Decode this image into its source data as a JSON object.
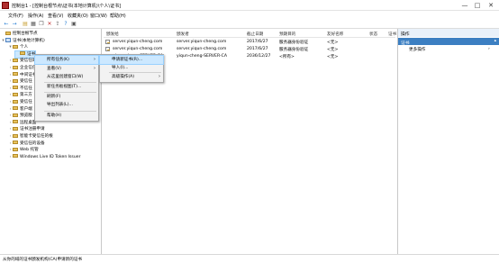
{
  "window": {
    "title": "控制台1 - [控制台根节点\\证书(本地计算机)\\个人\\证书]",
    "controls": [
      "—",
      "□",
      "✕"
    ]
  },
  "menubar": [
    "文件(F)",
    "操作(A)",
    "查看(V)",
    "收藏夹(O)",
    "窗口(W)",
    "帮助(H)"
  ],
  "toolbar_icons": [
    "back-icon",
    "forward-icon",
    "up-folder-icon",
    "console-tree-icon",
    "copy-icon",
    "delete-icon",
    "export-icon",
    "help-icon",
    "properties-icon"
  ],
  "tree": [
    {
      "label": "控制台根节点",
      "depth": 0,
      "twisty": "",
      "icon": "folder"
    },
    {
      "label": "证书(本地计算机)",
      "depth": 0,
      "twisty": "▾",
      "icon": "pc"
    },
    {
      "label": "个人",
      "depth": 1,
      "twisty": "▾",
      "icon": "folder"
    },
    {
      "label": "证书",
      "depth": 2,
      "twisty": "",
      "icon": "folder"
    },
    {
      "label": "受信任的",
      "depth": 1,
      "twisty": "›",
      "icon": "folder"
    },
    {
      "label": "企业信任",
      "depth": 1,
      "twisty": "›",
      "icon": "folder"
    },
    {
      "label": "中间证书",
      "depth": 1,
      "twisty": "›",
      "icon": "folder"
    },
    {
      "label": "受信任",
      "depth": 1,
      "twisty": "›",
      "icon": "folder"
    },
    {
      "label": "不信任",
      "depth": 1,
      "twisty": "›",
      "icon": "folder"
    },
    {
      "label": "第三方",
      "depth": 1,
      "twisty": "›",
      "icon": "folder"
    },
    {
      "label": "受信任",
      "depth": 1,
      "twisty": "›",
      "icon": "folder"
    },
    {
      "label": "客户端",
      "depth": 1,
      "twisty": "›",
      "icon": "folder"
    },
    {
      "label": "预览版",
      "depth": 1,
      "twisty": "›",
      "icon": "folder"
    },
    {
      "label": "远程桌面",
      "depth": 1,
      "twisty": "›",
      "icon": "folder"
    },
    {
      "label": "证书注册申请",
      "depth": 1,
      "twisty": "›",
      "icon": "folder"
    },
    {
      "label": "智能卡受信任的根",
      "depth": 1,
      "twisty": "›",
      "icon": "folder"
    },
    {
      "label": "受信任的设备",
      "depth": 1,
      "twisty": "›",
      "icon": "folder"
    },
    {
      "label": "Web 托管",
      "depth": 1,
      "twisty": "›",
      "icon": "folder"
    },
    {
      "label": "Windows Live ID Token Issuer",
      "depth": 1,
      "twisty": "›",
      "icon": "folder"
    }
  ],
  "list": {
    "columns": [
      "颁发给",
      "颁发者",
      "截止日期",
      "预期目的",
      "友好名称",
      "状态",
      "证书"
    ],
    "rows": [
      [
        "server.yiqun-cheng.com",
        "server.yiqun-cheng.com",
        "2017/6/27",
        "服务器身份验证",
        "<无>",
        "",
        ""
      ],
      [
        "server.yiqun-cheng.com",
        "server.yiqun-cheng.com",
        "2017/6/27",
        "服务器身份验证",
        "<无>",
        "",
        ""
      ],
      [
        "yiqun-cheng-SERVER-CA",
        "yiqun-cheng-SERVER-CA",
        "2036/12/27",
        "<所有>",
        "<无>",
        "",
        ""
      ]
    ]
  },
  "context_menu": [
    {
      "label": "所有任务(K)",
      "arrow": "›"
    },
    {
      "label": "查看(V)",
      "arrow": "›"
    },
    {
      "label": "从这里创建窗口(W)",
      "arrow": ""
    },
    {
      "label": "新任务板视图(T)...",
      "arrow": ""
    },
    {
      "label": "刷新(F)",
      "arrow": ""
    },
    {
      "label": "导出列表(L)...",
      "arrow": ""
    },
    {
      "label": "帮助(H)",
      "arrow": ""
    }
  ],
  "submenu": [
    {
      "label": "申请新证书(R)...",
      "arrow": ""
    },
    {
      "label": "导入(I)...",
      "arrow": ""
    },
    {
      "label": "高级操作(A)",
      "arrow": "›"
    }
  ],
  "actions": {
    "header": "操作",
    "selected": "证书",
    "more": "更多操作",
    "selected_arrow": "▴",
    "more_arrow": "›"
  },
  "status": "从你的域的证书颁发机构(CA)申请新的证书",
  "colors": {
    "accent": "#3c7fc2",
    "highlight": "#cce8ff",
    "folder": "#e8c25d"
  }
}
